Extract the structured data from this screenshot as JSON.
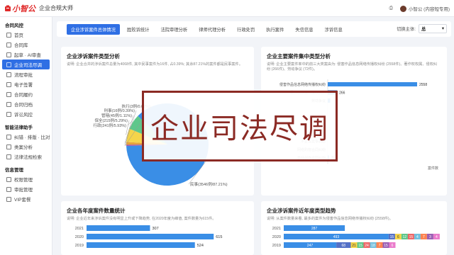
{
  "app": {
    "logo": "小智公",
    "title": "企业合规大师"
  },
  "topbar": {
    "user": "小智公 (内容短专用)"
  },
  "sidebar": {
    "groups": [
      {
        "label": "合同风控",
        "items": [
          "首页",
          "合同库",
          "起草 · AI审查",
          "企业司法尽调",
          "流程审批",
          "电子签署",
          "合同履约",
          "合同归档",
          "诉讼风控"
        ]
      },
      {
        "label": "智能法律助手",
        "items": [
          "纠错 · 排版 · 比对",
          "类案分析",
          "法律法规检索"
        ]
      },
      {
        "label": "信息管理",
        "items": [
          "权限管理",
          "审批管理",
          "VIP套餐"
        ]
      }
    ],
    "active": "企业司法尽调"
  },
  "tabs": [
    "企业涉诉案件总体情况",
    "胜败诉统计",
    "法院审理分析",
    "律师代理分析",
    "行政处罚",
    "执行案件",
    "失信信息",
    "涉诉信息"
  ],
  "active_tab": "企业涉诉案件总体情况",
  "switch": {
    "label": "切换主体:",
    "value": "总"
  },
  "overlay_text": "企业司法尽调",
  "cards": {
    "type_dist": {
      "title": "企业涉诉案件类型分析",
      "desc": "说明: 企业合并的涉诉案件总量为4068件, 其中民事案件为16件, 占0.39%; 其余87.21%的案件都是民事案件。"
    },
    "main_types": {
      "title": "企业主要案件集中类型分析",
      "desc": "说明: 企业主要案件率中的前三大类案由为: 侵害作品信息网络传播权纠纷 (2558件)、著作权权属、侵权纠纷 (266件)、劳动争议 (72件)。"
    },
    "yearly": {
      "title": "企业各年度案件数量统计",
      "desc": "说明: 企业近年来涉诉案件没有明显上升或下降趋势, 在2020年度为峰值, 案件数量为615件。"
    },
    "yearly_types": {
      "title": "企业涉诉案件近年度类型趋势",
      "desc": "说明: 从案件数量来看, 最多的案件为侵害作品信息网络传播权纠纷 (2558件)。"
    }
  },
  "chart_data": [
    {
      "type": "pie",
      "labels": [
        "民事(3546例/87.21%)",
        "执行(3例/0.07%)",
        "刑事(16例/0.39%)",
        "管辖(45例/1.11%)",
        "保全(215例/5.29%)",
        "行政(241例/5.93%)"
      ],
      "categories": [
        "民事",
        "执行",
        "刑事",
        "管辖",
        "保全",
        "行政"
      ],
      "values": [
        3546,
        3,
        16,
        45,
        215,
        241
      ],
      "colors": [
        "#3a8ee6",
        "#f56c6c",
        "#8e44ad",
        "#e6a23c",
        "#f5d44a",
        "#5ec78b"
      ]
    },
    {
      "type": "bar",
      "orientation": "horizontal",
      "categories": [
        "侵害作品信息网络传播权纠纷",
        "著作权权属、侵权纠纷",
        "劳动争议",
        "",
        "",
        "",
        "合同纠纷",
        "不正当竞争纠纷",
        "网络购物合同纠纷",
        "委托创作合同纠纷"
      ],
      "values": [
        2558,
        266,
        72,
        null,
        null,
        null,
        null,
        null,
        null,
        25
      ],
      "value_labels": [
        "2558",
        "266",
        "",
        "",
        "",
        "",
        "",
        "",
        "",
        "25"
      ],
      "xlabel": "案件数",
      "color": "#3a8ee6"
    },
    {
      "type": "bar",
      "orientation": "horizontal",
      "categories": [
        "2021",
        "2020",
        "2019"
      ],
      "values": [
        307,
        615,
        524
      ],
      "color": "#3a8ee6"
    },
    {
      "type": "bar",
      "orientation": "horizontal",
      "stacked": true,
      "categories": [
        "2021",
        "2020",
        "2019"
      ],
      "series_colors": [
        "#3a8ee6",
        "#5470c6",
        "#f5d44a",
        "#5ec78b",
        "#ee6666",
        "#73c0de",
        "#fc8452",
        "#9a60b4",
        "#ea7ccc"
      ],
      "rows": [
        {
          "year": "2021",
          "values": [
            287,
            0,
            0,
            0,
            0,
            0,
            0,
            0,
            0
          ],
          "labels": [
            "287",
            "",
            "",
            "",
            "",
            "",
            "",
            "",
            ""
          ]
        },
        {
          "year": "2020",
          "values": [
            493,
            15,
            6,
            12,
            15,
            4,
            7,
            3,
            4
          ],
          "labels": [
            "493",
            "15",
            "6",
            "12",
            "15",
            "4",
            "7",
            "3",
            "4"
          ]
        },
        {
          "year": "2019",
          "values": [
            247,
            68,
            21,
            15,
            24,
            18,
            7,
            15,
            6
          ],
          "labels": [
            "247",
            "68",
            "21",
            "15",
            "24",
            "18",
            "7",
            "15",
            "6"
          ]
        }
      ]
    }
  ]
}
